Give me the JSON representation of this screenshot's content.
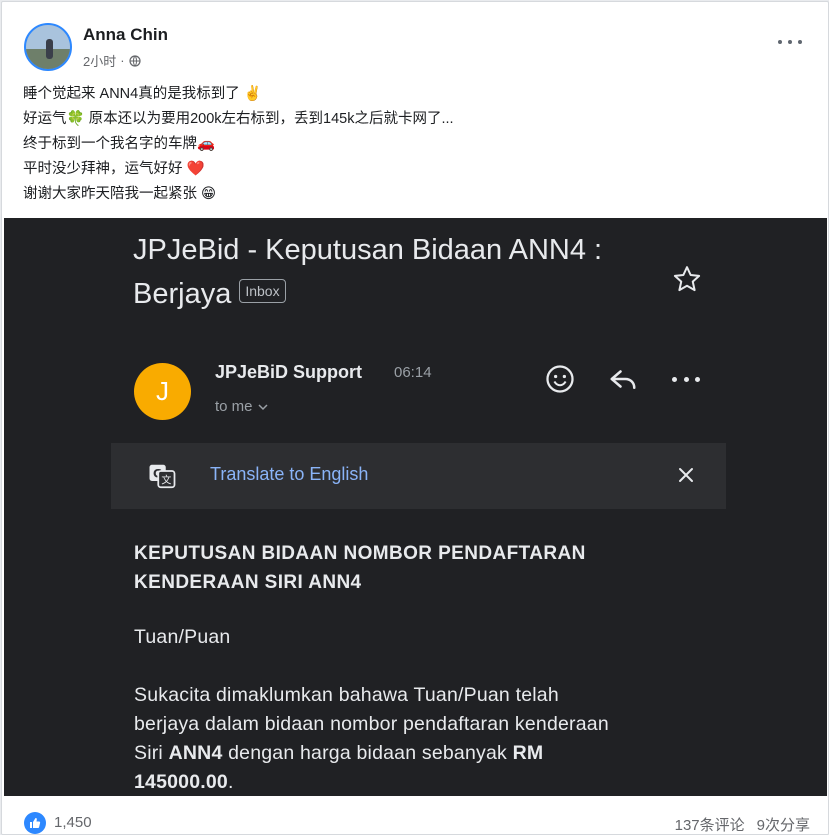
{
  "post": {
    "author": "Anna Chin",
    "time": "2小时",
    "lines": [
      "睡个觉起来 ANN4真的是我标到了 ✌️",
      "好运气🍀 原本还以为要用200k左右标到，丢到145k之后就卡网了...",
      "终于标到一个我名字的车牌🚗",
      "平时没少拜神，运气好好 ❤️",
      "谢谢大家昨天陪我一起紧张 😁"
    ]
  },
  "email": {
    "subject_line1": "JPJeBid - Keputusan Bidaan ANN4 :",
    "subject_line2": "Berjaya",
    "inbox_label": "Inbox",
    "sender_initial": "J",
    "sender_name": "JPJeBiD Support",
    "sender_time": "06:14",
    "to": "to me",
    "translate": "Translate to English",
    "heading_line1": "KEPUTUSAN BIDAAN NOMBOR PENDAFTARAN",
    "heading_line2": "KENDERAAN SIRI ANN4",
    "salutation": "Tuan/Puan",
    "para_line1": "Sukacita dimaklumkan bahawa Tuan/Puan telah",
    "para_line2": "berjaya dalam bidaan nombor pendaftaran kenderaan",
    "para_line3_a": "Siri ",
    "para_line3_b": "ANN4",
    "para_line3_c": " dengan harga bidaan sebanyak ",
    "para_line3_d": "RM",
    "para_line4_a": "145000.00",
    "para_line4_b": "."
  },
  "footer": {
    "likes": "1,450",
    "comments": "137条评论",
    "shares": "9次分享"
  },
  "colors": {
    "brand": "#2d88ff",
    "gmail_dark": "#202124",
    "avatar_yellow": "#f9ab00",
    "link_blue": "#8ab4f8"
  }
}
